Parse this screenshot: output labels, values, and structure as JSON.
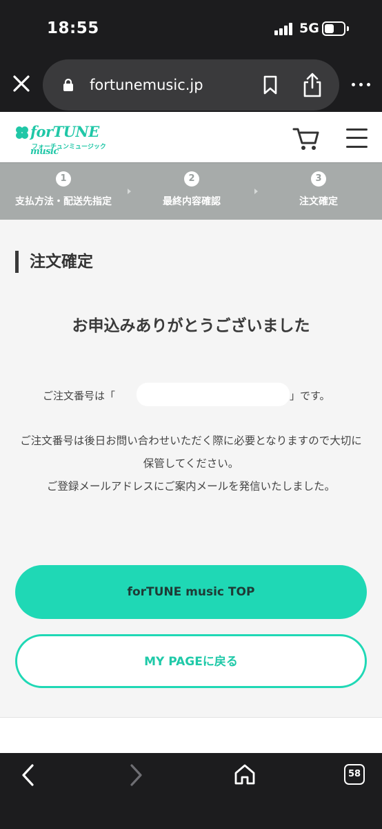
{
  "status": {
    "time": "18:55",
    "network": "5G"
  },
  "browser": {
    "url": "fortunemusic.jp",
    "tab_count": "58"
  },
  "site": {
    "logo_main": "forTUNE",
    "logo_small": "music",
    "logo_sub": "フォーチュンミュージック"
  },
  "steps": [
    {
      "num": "1",
      "label": "支払方法・配送先指定"
    },
    {
      "num": "2",
      "label": "最終内容確認"
    },
    {
      "num": "3",
      "label": "注文確定"
    }
  ],
  "main": {
    "title": "注文確定",
    "thanks": "お申込みありがとうございました",
    "order_prefix": "ご注文番号は「",
    "order_suffix": "」です。",
    "note_1": "ご注文番号は後日お問い合わせいただく際に必要となりますので大切に保管してください。",
    "note_2": "ご登録メールアドレスにご案内メールを発信いたしました。",
    "button_top": "forTUNE music TOP",
    "button_mypage": "MY PAGEに戻る"
  },
  "colors": {
    "accent": "#1fd8b5",
    "step_bg": "#a7abaa",
    "chrome_bg": "#1c1c1e"
  }
}
